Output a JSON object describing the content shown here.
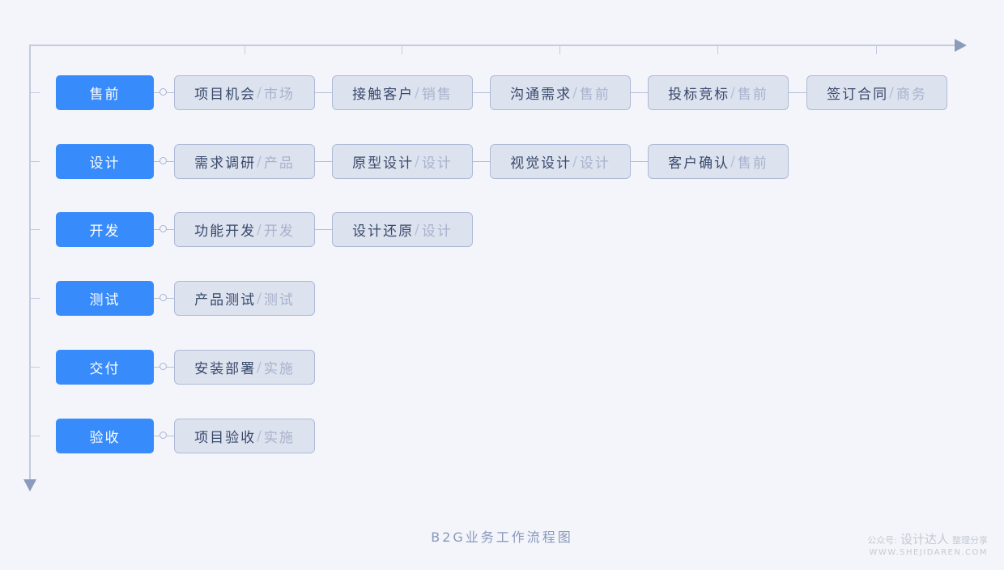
{
  "diagram": {
    "title": "B2G业务工作流程图",
    "separator": "/",
    "stages": [
      {
        "label": "售前",
        "tasks": [
          {
            "name": "项目机会",
            "role": "市场"
          },
          {
            "name": "接触客户",
            "role": "销售"
          },
          {
            "name": "沟通需求",
            "role": "售前"
          },
          {
            "name": "投标竞标",
            "role": "售前"
          },
          {
            "name": "签订合同",
            "role": "商务"
          }
        ]
      },
      {
        "label": "设计",
        "tasks": [
          {
            "name": "需求调研",
            "role": "产品"
          },
          {
            "name": "原型设计",
            "role": "设计"
          },
          {
            "name": "视觉设计",
            "role": "设计"
          },
          {
            "name": "客户确认",
            "role": "售前"
          }
        ]
      },
      {
        "label": "开发",
        "tasks": [
          {
            "name": "功能开发",
            "role": "开发"
          },
          {
            "name": "设计还原",
            "role": "设计"
          }
        ]
      },
      {
        "label": "测试",
        "tasks": [
          {
            "name": "产品测试",
            "role": "测试"
          }
        ]
      },
      {
        "label": "交付",
        "tasks": [
          {
            "name": "安装部署",
            "role": "实施"
          }
        ]
      },
      {
        "label": "验收",
        "tasks": [
          {
            "name": "项目验收",
            "role": "实施"
          }
        ]
      }
    ]
  },
  "watermark": {
    "prefix": "公众号:",
    "brand": "设计达人",
    "suffix": "整理分享",
    "url": "WWW.SHEJIDAREN.COM"
  },
  "colors": {
    "stage_fill": "#388bfb",
    "task_fill": "#dde2ef",
    "task_border": "#aebad6",
    "task_text": "#37496b",
    "role_text": "#a7b2cc",
    "axis": "#c3cbe0",
    "arrow": "#8b9bbb",
    "background": "#f3f5fa"
  }
}
